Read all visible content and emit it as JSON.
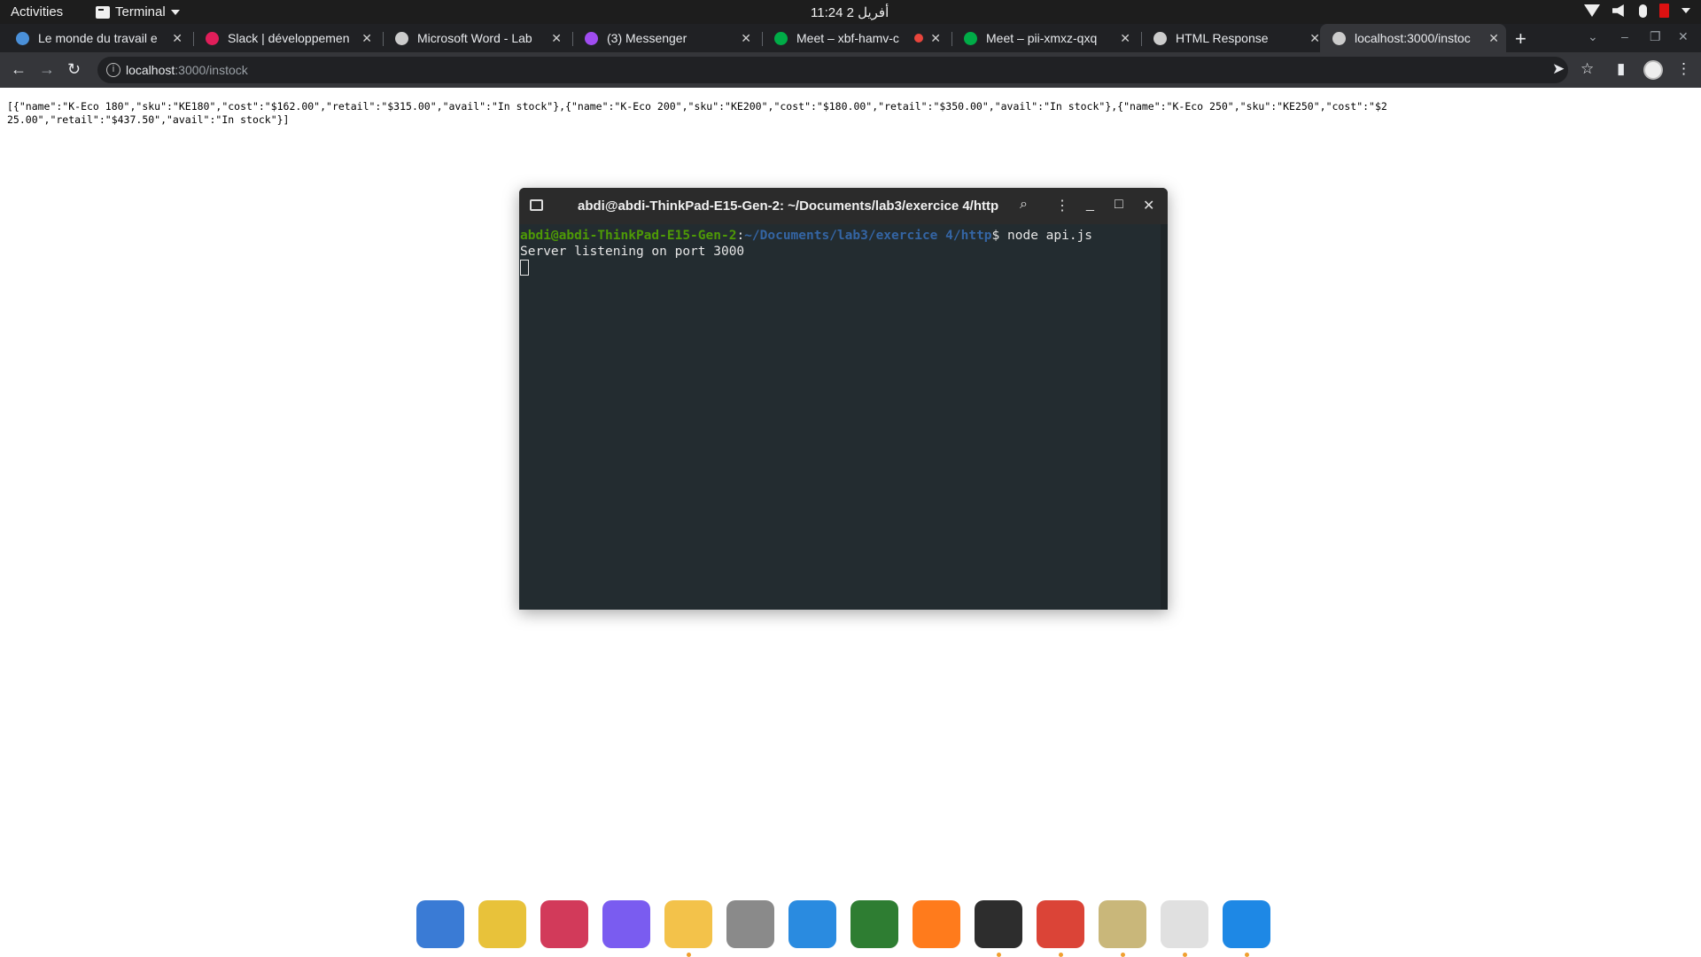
{
  "topbar": {
    "activities": "Activities",
    "app_name": "Terminal",
    "clock": "11:24  2 أفريل"
  },
  "tabs": [
    {
      "title": "Le monde du travail e",
      "favicon_color": "#4a90d9"
    },
    {
      "title": "Slack | développemen",
      "favicon_color": "#e01e5a"
    },
    {
      "title": "Microsoft Word - Lab",
      "favicon_color": "#cccccc"
    },
    {
      "title": "(3) Messenger",
      "favicon_color": "#a04cf0"
    },
    {
      "title": "Meet – xbf-hamv-c",
      "favicon_color": "#00ac47"
    },
    {
      "title": "Meet – pii-xmxz-qxq",
      "favicon_color": "#00ac47"
    },
    {
      "title": "HTML Response",
      "favicon_color": "#cccccc"
    },
    {
      "title": "localhost:3000/instoc",
      "favicon_color": "#cccccc"
    }
  ],
  "address_bar": {
    "host": "localhost",
    "path": ":3000/instock"
  },
  "page": {
    "json_text": "[{\"name\":\"K-Eco 180\",\"sku\":\"KE180\",\"cost\":\"$162.00\",\"retail\":\"$315.00\",\"avail\":\"In stock\"},{\"name\":\"K-Eco 200\",\"sku\":\"KE200\",\"cost\":\"$180.00\",\"retail\":\"$350.00\",\"avail\":\"In stock\"},{\"name\":\"K-Eco 250\",\"sku\":\"KE250\",\"cost\":\"$225.00\",\"retail\":\"$437.50\",\"avail\":\"In stock\"}]"
  },
  "terminal": {
    "title": "abdi@abdi-ThinkPad-E15-Gen-2: ~/Documents/lab3/exercice 4/http",
    "prompt_user": "abdi@abdi-ThinkPad-E15-Gen-2",
    "prompt_sep": ":",
    "prompt_path": "~/Documents/lab3/exercice 4/http",
    "prompt_suffix": "$ ",
    "command": "node api.js",
    "output": "Server listening on port 3000"
  },
  "dock": {
    "apps": [
      {
        "name": "thunderbird-icon",
        "color": "#3a7bd5"
      },
      {
        "name": "rhythmbox-icon",
        "color": "#e8c23a"
      },
      {
        "name": "draw-icon",
        "color": "#d23a5a"
      },
      {
        "name": "video-player-icon",
        "color": "#7a5cf0"
      },
      {
        "name": "text-editor-icon",
        "color": "#f3c24a"
      },
      {
        "name": "trash-icon",
        "color": "#8a8a8a"
      },
      {
        "name": "screen-icon",
        "color": "#2a8be0"
      },
      {
        "name": "radar-icon",
        "color": "#2e7d32"
      },
      {
        "name": "firefox-icon",
        "color": "#ff7b1c"
      },
      {
        "name": "terminal-icon",
        "color": "#2d2d2d"
      },
      {
        "name": "chrome-icon",
        "color": "#db4437"
      },
      {
        "name": "files-icon",
        "color": "#c9b77a"
      },
      {
        "name": "document-viewer-icon",
        "color": "#e0e0e0"
      },
      {
        "name": "vscode-icon",
        "color": "#1e88e5"
      }
    ]
  }
}
